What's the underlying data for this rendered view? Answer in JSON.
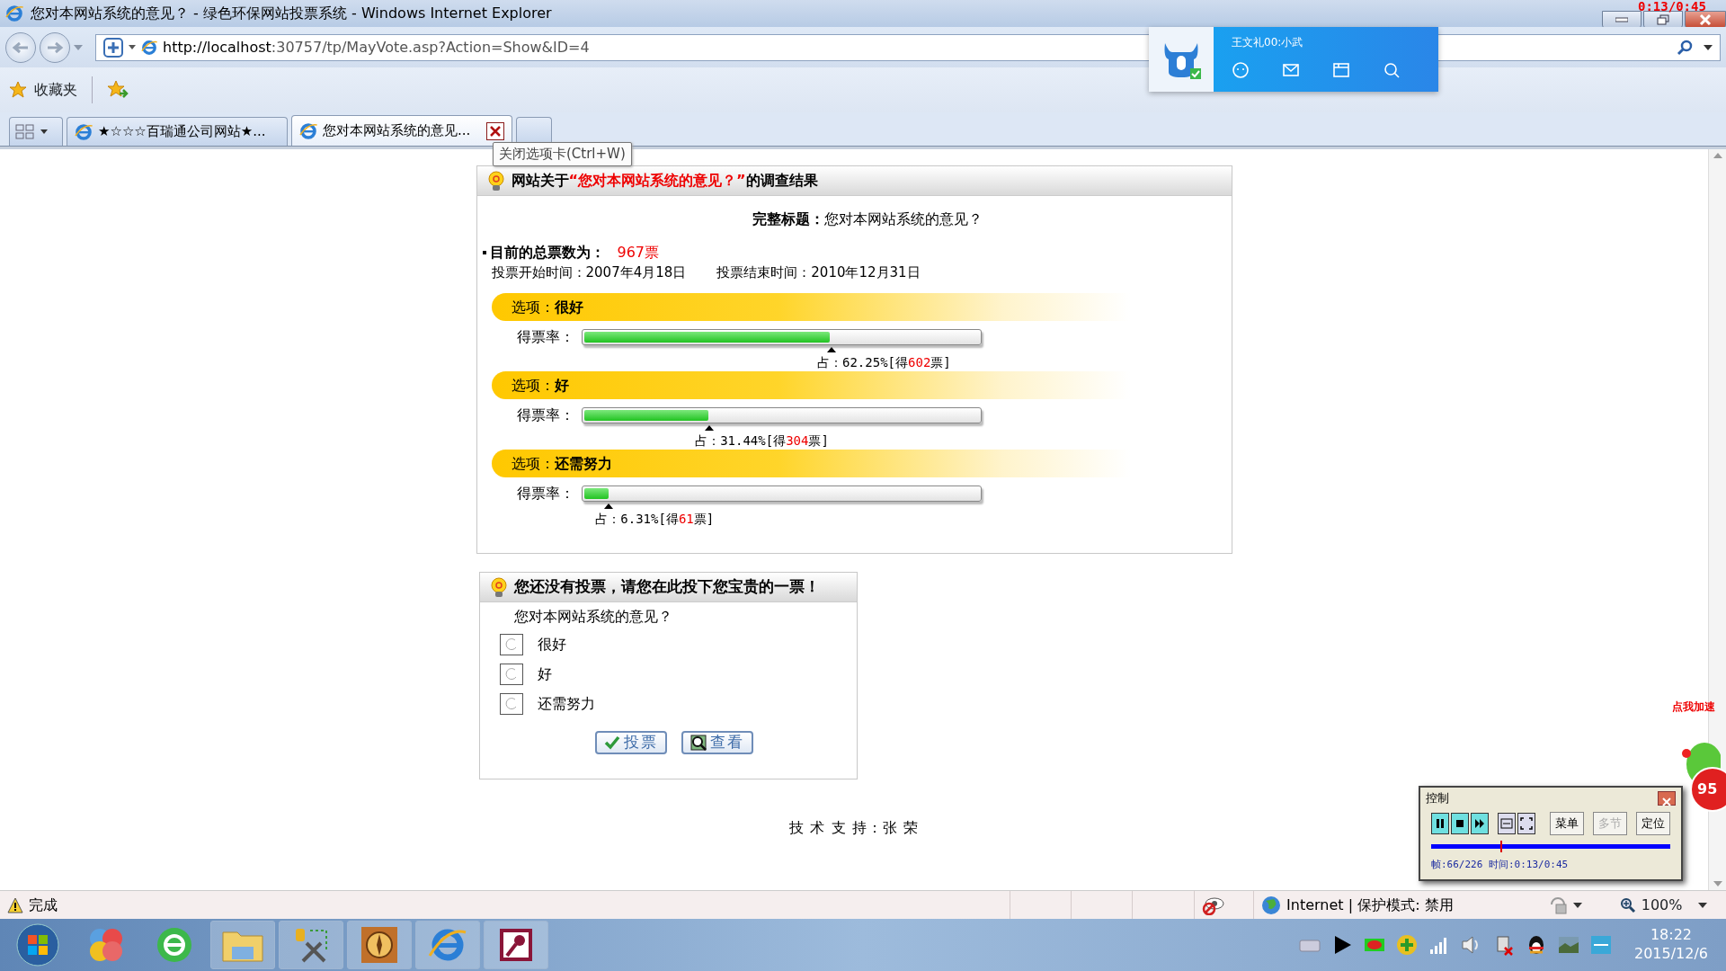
{
  "window": {
    "title": "您对本网站系统的意见？ - 绿色环保网站投票系统 - Windows Internet Explorer",
    "recorder_time": "0:13/0:45"
  },
  "address_bar": {
    "url_host": "http://localhost",
    "url_rest": ":30757/tp/MayVote.asp?Action=Show&ID=4"
  },
  "favorites_bar": {
    "label": "收藏夹"
  },
  "tabs": [
    {
      "label": "★☆☆☆百瑞通公司网站★...",
      "selected": false
    },
    {
      "label": "您对本网站系统的意见...",
      "selected": true
    }
  ],
  "tooltip": "关闭选项卡(Ctrl+W)",
  "qq_popup": {
    "name": "王文礼00:小武"
  },
  "poll": {
    "heading_prefix": "网站关于",
    "heading_topic": "“您对本网站系统的意见？”",
    "heading_suffix": "的调查结果",
    "full_title_label": "完整标题：",
    "full_title": "您对本网站系统的意见？",
    "total_label": "目前的总票数为：",
    "total": "967票",
    "start_label": "投票开始时间：",
    "start": "2007年4月18日",
    "end_label": "投票结束时间：",
    "end": "2010年12月31日",
    "options": [
      {
        "name": "选项：**很好**",
        "rate_label": "得票率：",
        "level": 0.6225,
        "share": "占：62.25%[得",
        "votes": "602",
        "share_end": "票]"
      },
      {
        "name": "选项：**好**",
        "rate_label": "得票率：",
        "level": 0.3144,
        "share": "占：31.44%[得",
        "votes": "304",
        "share_end": "票]"
      },
      {
        "name": "选项：**还需努力**",
        "rate_label": "得票率：",
        "level": 0.0631,
        "share": "占：6.31%[得",
        "votes": "61",
        "share_end": "票]"
      }
    ]
  },
  "vote": {
    "heading": "您还没有投票，请您在此投下您宝贵的一票！",
    "question": "您对本网站系统的意见？",
    "options": [
      {
        "label": "很好",
        "selected": false
      },
      {
        "label": "好",
        "selected": false
      },
      {
        "label": "还需努力",
        "selected": false
      }
    ],
    "buttons": [
      {
        "label": "投票",
        "kind": "vote"
      },
      {
        "label": "查看",
        "kind": "view"
      }
    ]
  },
  "footer": "技 术 支 持：张 荣",
  "status_bar": {
    "text": "完成",
    "zone": "Internet | 保护模式: 禁用",
    "zoom": "100%"
  },
  "control_window": {
    "title": "控制",
    "buttons": [
      {
        "label": "菜单",
        "disabled": false
      },
      {
        "label": "多节",
        "disabled": true
      },
      {
        "label": "定位",
        "disabled": false
      }
    ],
    "level": 0.29,
    "info": "帧:66/226 时间:0:13/0:45"
  },
  "speed_widget": {
    "label": "点我加速",
    "score": "95"
  },
  "clock": {
    "time": "18:22",
    "date": "2015/12/6"
  }
}
